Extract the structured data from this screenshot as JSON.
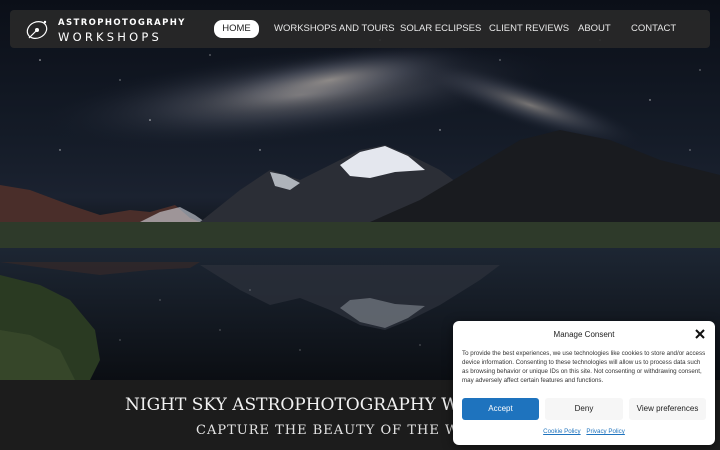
{
  "brand": {
    "line1": "ASTROPHOTOGRAPHY",
    "line2": "WORKSHOPS",
    "icon": "telescope-orbit-logo"
  },
  "nav": {
    "items": [
      {
        "label": "HOME",
        "active": true
      },
      {
        "label": "WORKSHOPS AND TOURS",
        "active": false
      },
      {
        "label": "SOLAR ECLIPSES",
        "active": false
      },
      {
        "label": "CLIENT REVIEWS",
        "active": false
      },
      {
        "label": "ABOUT",
        "active": false
      },
      {
        "label": "CONTACT",
        "active": false
      }
    ]
  },
  "hero": {
    "headline": "NIGHT SKY ASTROPHOTOGRAPHY WOR",
    "subheadline": "CAPTURE THE BEAUTY OF THE WORLD A"
  },
  "consent": {
    "title": "Manage Consent",
    "body": "To provide the best experiences, we use technologies like cookies to store and/or access device information. Consenting to these technologies will allow us to process data such as browsing behavior or unique IDs on this site. Not consenting or withdrawing consent, may adversely affect certain features and functions.",
    "accept_label": "Accept",
    "deny_label": "Deny",
    "preferences_label": "View preferences",
    "cookie_policy_label": "Cookie Policy",
    "privacy_policy_label": "Privacy Policy",
    "accent_color": "#1e73be"
  }
}
